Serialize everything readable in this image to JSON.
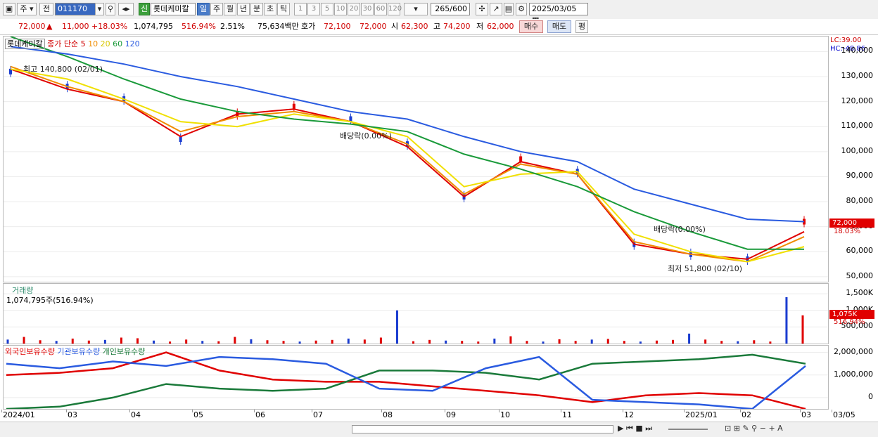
{
  "toolbar": {
    "market": "주",
    "prev": "전",
    "code": "011170",
    "new_badge": "신",
    "stock_name": "롯데케미칼",
    "periods": [
      "일",
      "주",
      "월",
      "년",
      "분",
      "초",
      "틱"
    ],
    "active_period": "일",
    "numbers": [
      "1",
      "3",
      "5",
      "10",
      "20",
      "30",
      "60",
      "120"
    ],
    "count": "265",
    "count_max": "/600",
    "date": "2025/03/05"
  },
  "quote": {
    "price": "72,000",
    "change": "11,000",
    "change_pct": "+18.03%",
    "volume": "1,074,795",
    "vol_ratio": "516.94%",
    "turnover": "2.51%",
    "amount": "75,634백만",
    "bid_label": "호가",
    "bid": "72,100",
    "ask": "72,000",
    "open_label": "시",
    "open": "62,300",
    "high_label": "고",
    "high": "74,200",
    "low_label": "저",
    "low": "62,000",
    "buy": "매수",
    "sell": "매도",
    "eval": "평"
  },
  "legend": {
    "name": "롯데케미칼",
    "series_label": "종가 단순",
    "ma": [
      "5",
      "10",
      "20",
      "60",
      "120"
    ]
  },
  "annotations": {
    "high": "최고 140,800 (02/01)",
    "low": "최저 51,800 (02/10)",
    "div1": "배당락(0.00%)",
    "div2": "배당락(0.00%)",
    "lc": "LC:39.00",
    "hc": "HC:-48.86",
    "price_tag": "72,000",
    "pct_tag": "18.03%",
    "vol_tag": "1,075K",
    "vol_pct_tag": "516.94%"
  },
  "volume_panel": {
    "title": "거래량",
    "value": "1,074,795주(516.94%)"
  },
  "holdings_panel": {
    "s1": "외국인보유수량",
    "s2": "기관보유수량",
    "s3": "개인보유수량"
  },
  "chart_data": [
    {
      "type": "line",
      "title": "롯데케미칼",
      "x_ticks": [
        "2024/01",
        "03",
        "04",
        "05",
        "06",
        "07",
        "08",
        "09",
        "10",
        "11",
        "12",
        "2025/01",
        "02",
        "03",
        "03/05"
      ],
      "y_ticks": [
        "140,000",
        "130,000",
        "120,000",
        "110,000",
        "100,000",
        "90,000",
        "80,000",
        "70,000",
        "60,000",
        "50,000"
      ],
      "ylim": [
        48000,
        146000
      ],
      "x": [
        "2024-01",
        "2024-02",
        "2024-03",
        "2024-04",
        "2024-05",
        "2024-06",
        "2024-07",
        "2024-08",
        "2024-09",
        "2024-10",
        "2024-11",
        "2024-12",
        "2025-01",
        "2025-02",
        "2025-03"
      ],
      "series": [
        {
          "name": "종가",
          "color": "#e00000",
          "values": [
            132000,
            126000,
            121000,
            105000,
            115000,
            118000,
            113000,
            103000,
            82000,
            97000,
            92000,
            63000,
            59000,
            57000,
            72000
          ]
        },
        {
          "name": "5",
          "color": "#e00000",
          "values": [
            133000,
            125000,
            120000,
            106000,
            115000,
            117000,
            112000,
            102000,
            82000,
            96000,
            91000,
            63000,
            59000,
            57000,
            68000
          ]
        },
        {
          "name": "10",
          "color": "#f08c00",
          "values": [
            134000,
            126000,
            120000,
            108000,
            114000,
            116000,
            112000,
            103000,
            83000,
            95000,
            91000,
            64000,
            59000,
            56000,
            66000
          ]
        },
        {
          "name": "20",
          "color": "#f0e000",
          "values": [
            133000,
            129000,
            121000,
            112000,
            110000,
            115000,
            112000,
            106000,
            86000,
            91000,
            92000,
            67000,
            60000,
            56000,
            62000
          ]
        },
        {
          "name": "60",
          "color": "#1a9a3a",
          "values": [
            146000,
            138000,
            129000,
            121000,
            116000,
            113000,
            111000,
            108000,
            99000,
            93000,
            86000,
            76000,
            68000,
            61000,
            61000
          ]
        },
        {
          "name": "120",
          "color": "#2a5be0",
          "values": [
            142000,
            139000,
            135000,
            130000,
            126000,
            121000,
            116000,
            113000,
            106000,
            100000,
            96000,
            85000,
            79000,
            73000,
            72000
          ]
        }
      ]
    },
    {
      "type": "bar",
      "title": "거래량",
      "y_ticks": [
        "1,500K",
        "1,000K",
        "500,000"
      ],
      "ylim": [
        0,
        1800
      ],
      "values": [
        120,
        200,
        100,
        80,
        150,
        90,
        110,
        180,
        160,
        90,
        60,
        120,
        80,
        70,
        200,
        130,
        100,
        80,
        60,
        90,
        110,
        150,
        120,
        180,
        1000,
        70,
        110,
        90,
        80,
        60,
        150,
        220,
        80,
        60,
        130,
        80,
        120,
        140,
        80,
        60,
        90,
        110,
        300,
        120,
        80,
        70,
        100,
        60,
        1400,
        850
      ]
    },
    {
      "type": "line",
      "title": "보유수량",
      "y_ticks": [
        "2,000,000",
        "1,000,000",
        "0"
      ],
      "ylim": [
        -500000,
        2300000
      ],
      "series": [
        {
          "name": "외국인보유수량",
          "color": "#e00000",
          "values": [
            1000000,
            1100000,
            1300000,
            2000000,
            1200000,
            800000,
            700000,
            700000,
            500000,
            300000,
            100000,
            -200000,
            100000,
            200000,
            100000,
            -500000
          ]
        },
        {
          "name": "기관보유수량",
          "color": "#1a7a3a",
          "values": [
            -500000,
            -400000,
            0,
            600000,
            400000,
            300000,
            400000,
            1200000,
            1200000,
            1100000,
            800000,
            1500000,
            1600000,
            1700000,
            1900000,
            1500000
          ]
        },
        {
          "name": "개인보유수량",
          "color": "#2a5be0",
          "values": [
            1500000,
            1300000,
            1600000,
            1400000,
            1800000,
            1700000,
            1500000,
            400000,
            300000,
            1300000,
            1800000,
            -100000,
            -200000,
            -300000,
            -500000,
            1400000
          ]
        }
      ]
    }
  ]
}
